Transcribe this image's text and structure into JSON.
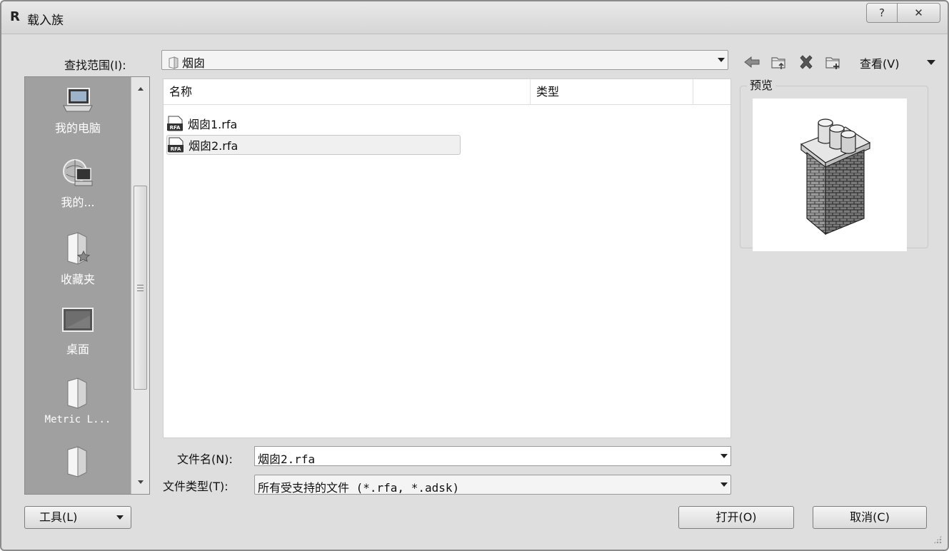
{
  "window": {
    "title": "载入族",
    "app_icon": "R",
    "help_label": "?",
    "close_label": "✕"
  },
  "lookin": {
    "label": "查找范围(I):",
    "value": "烟囱"
  },
  "toolbar": {
    "back_icon": "back-arrow-icon",
    "up_icon": "up-folder-icon",
    "delete_icon": "delete-icon",
    "new_folder_icon": "new-folder-icon",
    "view_label": "查看(V)"
  },
  "places": [
    {
      "label": "我的电脑",
      "icon": "computer-icon"
    },
    {
      "label": "我的...",
      "icon": "network-computer-icon"
    },
    {
      "label": "收藏夹",
      "icon": "favorites-folder-icon"
    },
    {
      "label": "桌面",
      "icon": "desktop-icon"
    },
    {
      "label": "Metric L...",
      "icon": "folder-icon"
    },
    {
      "label": "",
      "icon": "folder-icon"
    }
  ],
  "filelist": {
    "columns": [
      "名称",
      "类型"
    ],
    "files": [
      {
        "name": "烟囱1.rfa",
        "icon": "rfa-file-icon",
        "selected": false
      },
      {
        "name": "烟囱2.rfa",
        "icon": "rfa-file-icon",
        "selected": true
      }
    ]
  },
  "preview": {
    "label": "预览",
    "image": "chimney-model-preview"
  },
  "filename": {
    "label": "文件名(N):",
    "value": "烟囱2.rfa"
  },
  "filetype": {
    "label": "文件类型(T):",
    "value": "所有受支持的文件 (*.rfa, *.adsk)"
  },
  "buttons": {
    "tools": "工具(L)",
    "open": "打开(O)",
    "cancel": "取消(C)"
  },
  "colors": {
    "dialog_bg": "#dedede",
    "places_bg": "#a0a0a0",
    "list_bg": "#ffffff"
  }
}
